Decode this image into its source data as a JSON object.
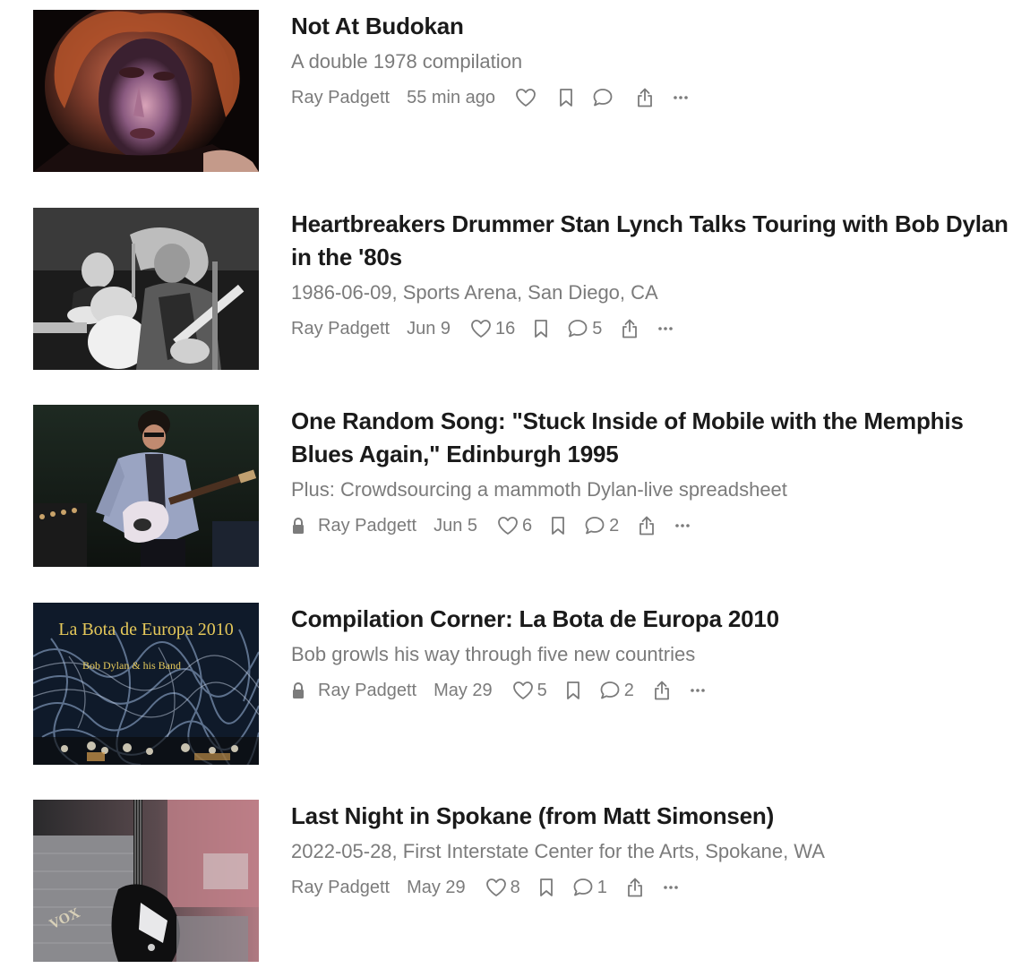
{
  "posts": [
    {
      "title": "Not At Budokan",
      "subtitle": "A double 1978 compilation",
      "author": "Ray Padgett",
      "date": "55 min ago",
      "likes": "",
      "comments": "",
      "locked": false,
      "thumbnail_text": ""
    },
    {
      "title": "Heartbreakers Drummer Stan Lynch Talks Touring with Bob Dylan in the '80s",
      "subtitle": "1986-06-09, Sports Arena, San Diego, CA",
      "author": "Ray Padgett",
      "date": "Jun 9",
      "likes": "16",
      "comments": "5",
      "locked": false,
      "thumbnail_text": ""
    },
    {
      "title": "One Random Song: \"Stuck Inside of Mobile with the Memphis Blues Again,\" Edinburgh 1995",
      "subtitle": "Plus: Crowdsourcing a mammoth Dylan-live spreadsheet",
      "author": "Ray Padgett",
      "date": "Jun 5",
      "likes": "6",
      "comments": "2",
      "locked": true,
      "thumbnail_text": ""
    },
    {
      "title": "Compilation Corner: La Bota de Europa 2010",
      "subtitle": "Bob growls his way through five new countries",
      "author": "Ray Padgett",
      "date": "May 29",
      "likes": "5",
      "comments": "2",
      "locked": true,
      "thumbnail_text": "La Bota de Europa 2010",
      "thumbnail_subtext": "Bob Dylan & his Band"
    },
    {
      "title": "Last Night in Spokane (from Matt Simonsen)",
      "subtitle": "2022-05-28, First Interstate Center for the Arts, Spokane, WA",
      "author": "Ray Padgett",
      "date": "May 29",
      "likes": "8",
      "comments": "1",
      "locked": false,
      "thumbnail_text": "VOX"
    }
  ],
  "icons": {
    "like": "heart-icon",
    "save": "bookmark-icon",
    "comment": "comment-icon",
    "share": "share-icon",
    "more": "ellipsis-icon",
    "paywall": "lock-icon"
  },
  "colors": {
    "title": "#1a1a1a",
    "muted": "#7b7b7b",
    "background": "#ffffff"
  }
}
